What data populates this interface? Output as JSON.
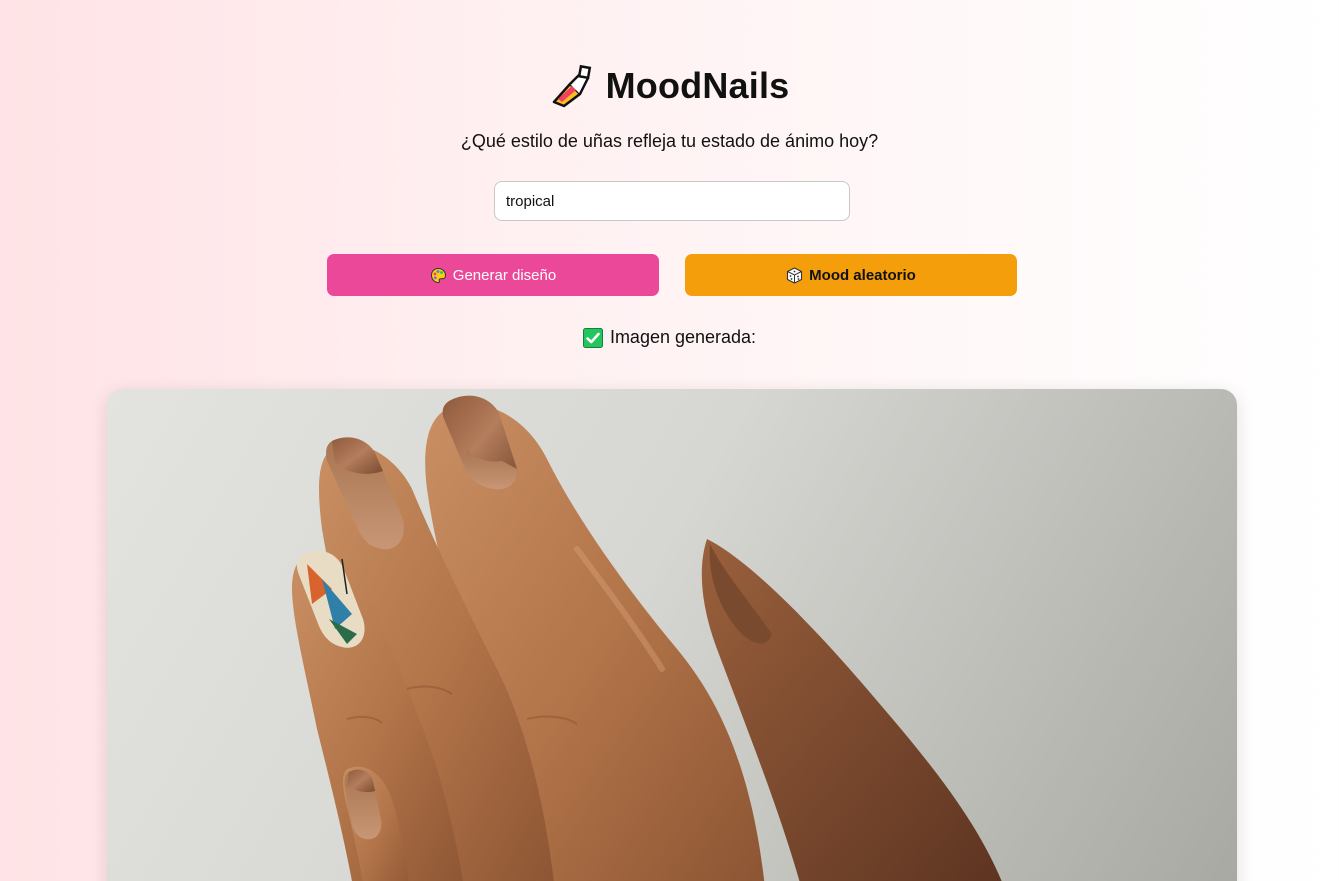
{
  "app": {
    "title": "MoodNails",
    "logo_icon": "nail-polish-brush-icon"
  },
  "prompt": {
    "question": "¿Qué estilo de uñas refleja tu estado de ánimo hoy?",
    "input_value": "tropical",
    "input_placeholder": ""
  },
  "actions": {
    "generate_label": "Generar diseño",
    "generate_icon": "palette-icon",
    "random_label": "Mood aleatorio",
    "random_icon": "dice-icon"
  },
  "status": {
    "icon": "checkmark-icon",
    "text": "Imagen generada:"
  },
  "result_image": {
    "subject": "hand-with-tropical-nail-design"
  },
  "colors": {
    "generate_button": "#ec4899",
    "random_button": "#f59e0b",
    "check": "#22c55e"
  }
}
